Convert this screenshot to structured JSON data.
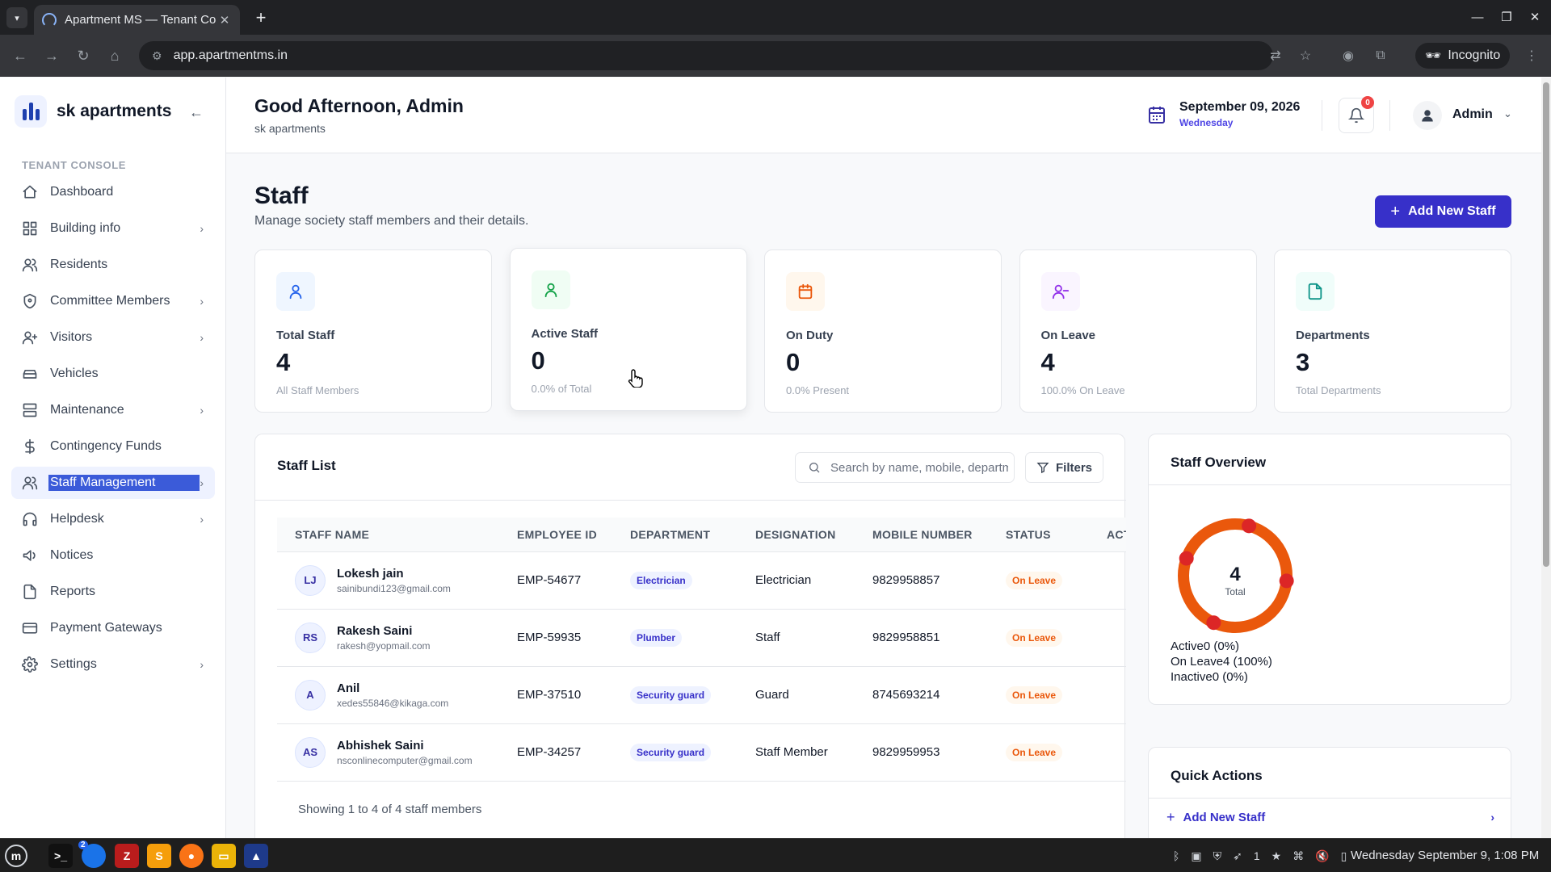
{
  "browser": {
    "tab_title": "Apartment MS — Tenant Co",
    "url": "app.apartmentms.in",
    "profile_label": "Incognito"
  },
  "sidebar": {
    "brand_name": "sk apartments",
    "section_label": "TENANT CONSOLE",
    "items": [
      {
        "label": "Dashboard",
        "icon": "home-icon",
        "has_chevron": false
      },
      {
        "label": "Building info",
        "icon": "grid-icon",
        "has_chevron": true
      },
      {
        "label": "Residents",
        "icon": "users-icon",
        "has_chevron": false
      },
      {
        "label": "Committee Members",
        "icon": "shield-icon",
        "has_chevron": true
      },
      {
        "label": "Visitors",
        "icon": "user-plus-icon",
        "has_chevron": true
      },
      {
        "label": "Vehicles",
        "icon": "car-icon",
        "has_chevron": false
      },
      {
        "label": "Maintenance",
        "icon": "server-icon",
        "has_chevron": true
      },
      {
        "label": "Contingency Funds",
        "icon": "dollar-icon",
        "has_chevron": false
      },
      {
        "label": "Staff Management",
        "icon": "users-icon",
        "has_chevron": true,
        "active": true
      },
      {
        "label": "Helpdesk",
        "icon": "headphones-icon",
        "has_chevron": true
      },
      {
        "label": "Notices",
        "icon": "megaphone-icon",
        "has_chevron": false
      },
      {
        "label": "Reports",
        "icon": "file-icon",
        "has_chevron": false
      },
      {
        "label": "Payment Gateways",
        "icon": "credit-card-icon",
        "has_chevron": false
      },
      {
        "label": "Settings",
        "icon": "gear-icon",
        "has_chevron": true
      }
    ]
  },
  "header": {
    "greeting": "Good Afternoon, Admin",
    "society": "sk apartments",
    "date": "September 09, 2026",
    "weekday": "Wednesday",
    "notification_count": "0",
    "user_name": "Admin"
  },
  "page": {
    "title": "Staff",
    "subtitle": "Manage society staff members and their details.",
    "add_button": "Add New Staff"
  },
  "stats": [
    {
      "label": "Total Staff",
      "value": "4",
      "sub": "All Staff Members",
      "icon": "user-icon",
      "color": "#2563eb",
      "bg": "#eff6ff"
    },
    {
      "label": "Active Staff",
      "value": "0",
      "sub": "0.0% of Total",
      "icon": "user-check-icon",
      "color": "#16a34a",
      "bg": "#f0fdf4"
    },
    {
      "label": "On Duty",
      "value": "0",
      "sub": "0.0% Present",
      "icon": "calendar-icon",
      "color": "#ea580c",
      "bg": "#fff7ed"
    },
    {
      "label": "On Leave",
      "value": "4",
      "sub": "100.0% On Leave",
      "icon": "user-minus-icon",
      "color": "#9333ea",
      "bg": "#faf5ff"
    },
    {
      "label": "Departments",
      "value": "3",
      "sub": "Total Departments",
      "icon": "document-icon",
      "color": "#0d9488",
      "bg": "#f0fdfa"
    }
  ],
  "staff_list": {
    "title": "Staff List",
    "search_placeholder": "Search by name, mobile, department...",
    "filters_label": "Filters",
    "columns": [
      "STAFF NAME",
      "EMPLOYEE ID",
      "DEPARTMENT",
      "DESIGNATION",
      "MOBILE NUMBER",
      "STATUS",
      "ACTIONS"
    ],
    "rows": [
      {
        "initials": "LJ",
        "name": "Lokesh jain",
        "email": "sainibundi123@gmail.com",
        "employee_id": "EMP-54677",
        "department": "Electrician",
        "designation": "Electrician",
        "mobile": "9829958857",
        "status": "On Leave"
      },
      {
        "initials": "RS",
        "name": "Rakesh Saini",
        "email": "rakesh@yopmail.com",
        "employee_id": "EMP-59935",
        "department": "Plumber",
        "designation": "Staff",
        "mobile": "9829958851",
        "status": "On Leave"
      },
      {
        "initials": "A",
        "name": "Anil",
        "email": "xedes55846@kikaga.com",
        "employee_id": "EMP-37510",
        "department": "Security guard",
        "designation": "Guard",
        "mobile": "8745693214",
        "status": "On Leave"
      },
      {
        "initials": "AS",
        "name": "Abhishek Saini",
        "email": "nsconlinecomputer@gmail.com",
        "employee_id": "EMP-34257",
        "department": "Security guard",
        "designation": "Staff Member",
        "mobile": "9829959953",
        "status": "On Leave"
      }
    ],
    "footer": "Showing 1 to 4 of 4 staff members"
  },
  "overview": {
    "title": "Staff Overview",
    "total_value": "4",
    "total_label": "Total",
    "legend": [
      "Active0 (0%)",
      "On Leave4 (100%)",
      "Inactive0 (0%)"
    ],
    "chart_data": {
      "type": "pie",
      "categories": [
        "Active",
        "On Leave",
        "Inactive"
      ],
      "values": [
        0,
        4,
        0
      ],
      "colors": [
        "#16a34a",
        "#ea580c",
        "#9ca3af"
      ]
    }
  },
  "quick_actions": {
    "title": "Quick Actions",
    "items": [
      {
        "label": "Add New Staff"
      }
    ]
  },
  "taskbar": {
    "clock": "Wednesday September 9, 1:08 PM",
    "chrome_badge": "2",
    "tray_count": "1"
  }
}
